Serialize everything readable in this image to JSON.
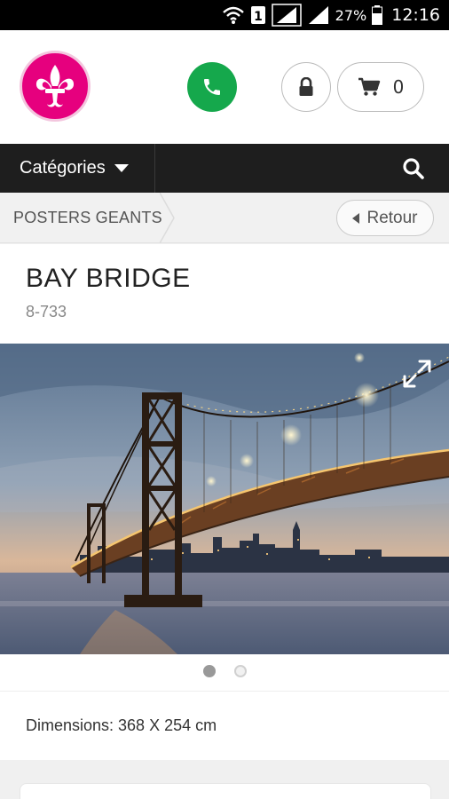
{
  "status_bar": {
    "battery_text": "27%",
    "time": "12:16",
    "icons": [
      "wifi-icon",
      "sim-1-icon",
      "signal-icon",
      "signal-icon-2",
      "battery-icon"
    ]
  },
  "header": {
    "logo_icon": "fleur-de-lis-icon",
    "brand_color": "#e6007e",
    "phone_color": "#15a84c",
    "cart_count": "0"
  },
  "nav": {
    "categories_label": "Catégories"
  },
  "breadcrumb": {
    "current": "POSTERS GEANTS",
    "back_label": "Retour"
  },
  "product": {
    "title": "BAY BRIDGE",
    "ref": "8-733",
    "dimensions": "Dimensions: 368 X 254 cm",
    "gallery": {
      "slide_count": 2,
      "active_index": 0
    }
  }
}
